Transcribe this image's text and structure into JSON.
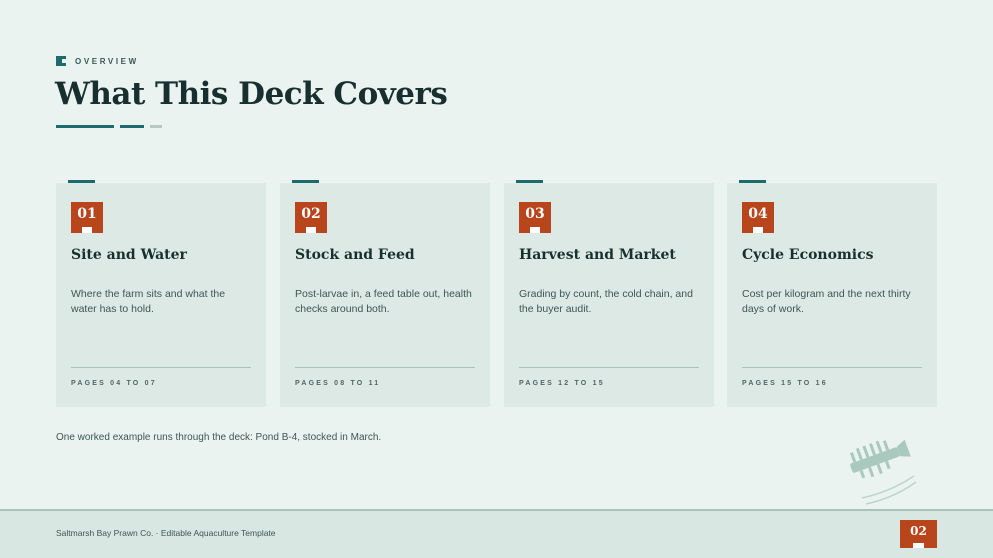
{
  "header": {
    "eyebrow": "OVERVIEW",
    "title": "What This Deck Covers"
  },
  "cards": [
    {
      "number": "01",
      "title": "Site and Water",
      "description": "Where the farm sits and what the water has to hold.",
      "pages": "PAGES 04 TO 07"
    },
    {
      "number": "02",
      "title": "Stock and Feed",
      "description": "Post-larvae in, a feed table out, health checks around both.",
      "pages": "PAGES 08 TO 11"
    },
    {
      "number": "03",
      "title": "Harvest and Market",
      "description": "Grading by count, the cold chain, and the buyer audit.",
      "pages": "PAGES 12 TO 15"
    },
    {
      "number": "04",
      "title": "Cycle Economics",
      "description": "Cost per kilogram and the next thirty days of work.",
      "pages": "PAGES 15 TO 16"
    }
  ],
  "footnote": "One worked example runs through the deck: Pond B-4, stocked in March.",
  "footer": {
    "brand": "Saltmarsh Bay Prawn Co. · Editable Aquaculture Template",
    "page_number": "02"
  },
  "colors": {
    "background": "#ebf3f0",
    "accent_teal": "#1e6b6e",
    "accent_rust": "#b8451c",
    "card": "#dde9e5"
  },
  "decoration": "prawn-icon"
}
